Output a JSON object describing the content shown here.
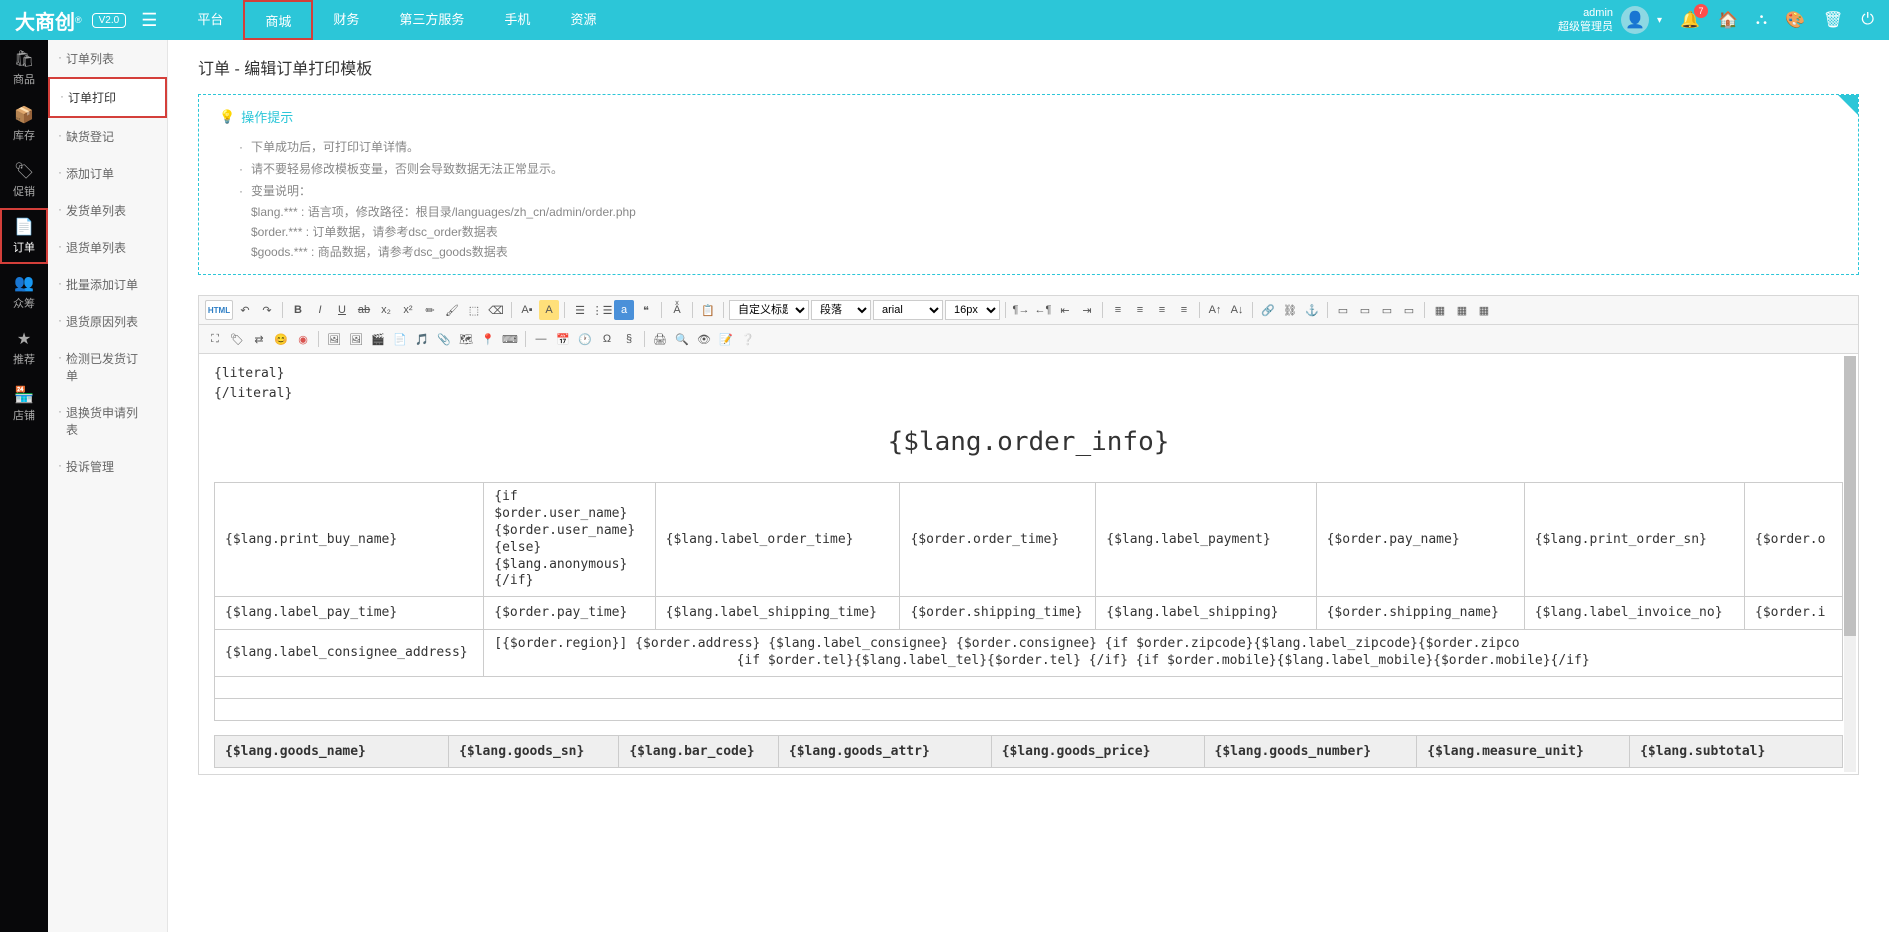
{
  "header": {
    "logo_text": "大商创",
    "version": "V2.0",
    "nav": [
      "平台",
      "商城",
      "财务",
      "第三方服务",
      "手机",
      "资源"
    ],
    "active_nav": 1,
    "user_name": "admin",
    "user_role": "超级管理员",
    "notif_count": "7"
  },
  "rail": {
    "items": [
      {
        "icon": "🛍",
        "label": "商品"
      },
      {
        "icon": "📦",
        "label": "库存"
      },
      {
        "icon": "🏷",
        "label": "促销"
      },
      {
        "icon": "📄",
        "label": "订单"
      },
      {
        "icon": "👥",
        "label": "众筹"
      },
      {
        "icon": "★",
        "label": "推荐"
      },
      {
        "icon": "🏪",
        "label": "店铺"
      }
    ],
    "active": 3
  },
  "sidebar": {
    "items": [
      "订单列表",
      "订单打印",
      "缺货登记",
      "添加订单",
      "发货单列表",
      "退货单列表",
      "批量添加订单",
      "退货原因列表",
      "检测已发货订单",
      "退换货申请列表",
      "投诉管理"
    ],
    "active": 1
  },
  "page": {
    "title": "订单 - 编辑订单打印模板"
  },
  "tips": {
    "title": "操作提示",
    "items": [
      "下单成功后，可打印订单详情。",
      "请不要轻易修改模板变量，否则会导致数据无法正常显示。",
      "变量说明："
    ],
    "subs": [
      "$lang.*** : 语言项，修改路径：根目录/languages/zh_cn/admin/order.php",
      "$order.*** : 订单数据，请参考dsc_order数据表",
      "$goods.*** : 商品数据，请参考dsc_goods数据表"
    ]
  },
  "toolbar": {
    "selects": {
      "heading": "自定义标题",
      "paragraph": "段落",
      "font": "arial",
      "size": "16px"
    }
  },
  "editor": {
    "pre_lines": [
      "{literal}",
      "{/literal}"
    ],
    "title": "{$lang.order_info}",
    "row1": [
      "{$lang.print_buy_name}",
      "{if $order.user_name}\n{$order.user_name}\n{else}\n{$lang.anonymous}\n{/if}",
      "{$lang.label_order_time}",
      "{$order.order_time}",
      "{$lang.label_payment}",
      "{$order.pay_name}",
      "{$lang.print_order_sn}",
      "{$order.o"
    ],
    "row2": [
      "{$lang.label_pay_time}",
      "{$order.pay_time}",
      "{$lang.label_shipping_time}",
      "{$order.shipping_time}",
      "{$lang.label_shipping}",
      "{$order.shipping_name}",
      "{$lang.label_invoice_no}",
      "{$order.i"
    ],
    "row3_c1": "{$lang.label_consignee_address}",
    "row3_c2_line1": "[{$order.region}]   {$order.address}                        {$lang.label_consignee}  {$order.consignee}                           {if $order.zipcode}{$lang.label_zipcode}{$order.zipco",
    "row3_c2_line2": "{if $order.tel}{$lang.label_tel}{$order.tel}   {/if}              {if $order.mobile}{$lang.label_mobile}{$order.mobile}{/if}",
    "goods_header": [
      "{$lang.goods_name}",
      "{$lang.goods_sn}",
      "{$lang.bar_code}",
      "{$lang.goods_attr}",
      "{$lang.goods_price}",
      "{$lang.goods_number}",
      "{$lang.measure_unit}",
      "{$lang.subtotal}"
    ]
  }
}
